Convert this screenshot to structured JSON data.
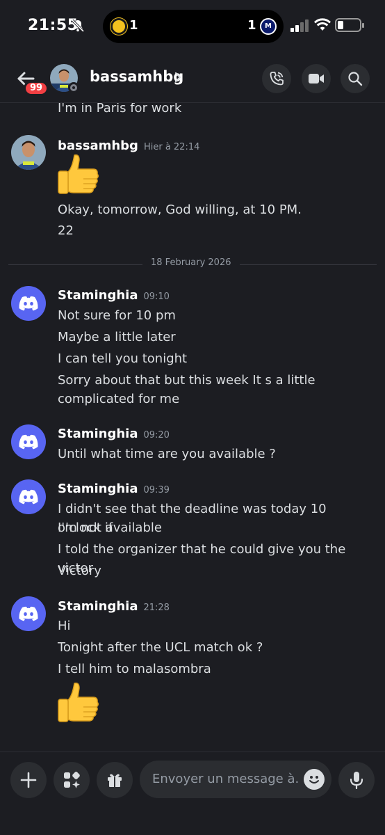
{
  "status_bar": {
    "time": "21:55",
    "score_left": "1",
    "score_right": "1",
    "icons": [
      "bell-muted-icon",
      "signal-icon",
      "wifi-icon",
      "battery-icon"
    ]
  },
  "header": {
    "username": "bassamhbg",
    "unread_count": "99",
    "icons": [
      "back-arrow-icon",
      "call-icon",
      "video-icon",
      "search-icon"
    ]
  },
  "messages": {
    "prev_line": "I'm in Paris for work",
    "group1": {
      "author": "bassamhbg",
      "time": "Hier à 22:14",
      "lines": [
        "Okay, tomorrow, God willing, at 10 PM.",
        "22"
      ]
    },
    "date_divider": "18 February 2026",
    "group2": {
      "author": "Staminghia",
      "time": "09:10",
      "lines": [
        "Not sure for 10 pm",
        "Maybe a little later",
        "I can tell you tonight",
        "Sorry about that but this week It s a little",
        "complicated for me"
      ]
    },
    "group3": {
      "author": "Staminghia",
      "time": "09:20",
      "lines": [
        "Until what time are you available ?"
      ]
    },
    "group4": {
      "author": "Staminghia",
      "time": "09:39",
      "lines": [
        "I didn't see that the deadline was today 10 o'clock if",
        "I'm not available",
        "I told the organizer that he could give you the victor",
        "Victory"
      ]
    },
    "group5": {
      "author": "Staminghia",
      "time": "21:28",
      "lines": [
        "Hi",
        "Tonight after the UCL match ok ?",
        "I tell him to malasombra"
      ]
    }
  },
  "composer": {
    "placeholder": "Envoyer un message à...",
    "icons": [
      "plus-icon",
      "apps-icon",
      "gift-icon",
      "emoji-icon",
      "microphone-icon"
    ]
  },
  "colors": {
    "background": "#1c1d22",
    "blurple": "#5865f2",
    "badge_red": "#f23f43",
    "muted_text": "#949ba4"
  }
}
